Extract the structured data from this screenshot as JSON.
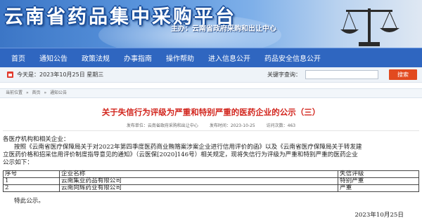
{
  "header": {
    "site_title": "云南省药品集中采购平台",
    "sponsor": "主办：云南省政府采购和出让中心"
  },
  "nav": {
    "items": [
      "首页",
      "通知公告",
      "政策法规",
      "办事指南",
      "操作帮助",
      "进入信息公开",
      "药品安全信息公开"
    ]
  },
  "infobar": {
    "date_text": "今天是：2023年10月25日 星期三",
    "keyword_label": "关键字查询：",
    "search_placeholder": "",
    "search_button": "搜索"
  },
  "breadcrumb": [
    "当前位置",
    "»",
    "首页",
    "»",
    "通知公告"
  ],
  "article": {
    "title": "关于失信行为评级为严重和特别严重的医药企业的公示（三）",
    "meta": {
      "publisher": "发布单位：云南省政府采购和出让中心",
      "date": "发布时间：2023-10-25",
      "views": "访问次数：463"
    },
    "greeting": "各医疗机构和相关企业：",
    "para_lines": [
      "按照《云南省医疗保障局关于对2022年第四季度医药商业贿赂案涉案企业进行信用评价的函》以及《云南省医疗保障局关于转发建",
      "立医药价格和招采信用评价制度指导意见的通知》（云医保[2020]146号）相关规定，现将失信行为评级为严重和特别严重的医药企业",
      "公示如下："
    ],
    "table": {
      "headers": [
        "序号",
        "企业名称",
        "失信评级"
      ],
      "rows": [
        [
          "1",
          "云南集业药品有限公司",
          "特别严重"
        ],
        [
          "2",
          "云南向辉药业有限公司",
          "严重"
        ]
      ]
    },
    "closing": "特此公示。",
    "sign_date": "2023年10月25日"
  }
}
